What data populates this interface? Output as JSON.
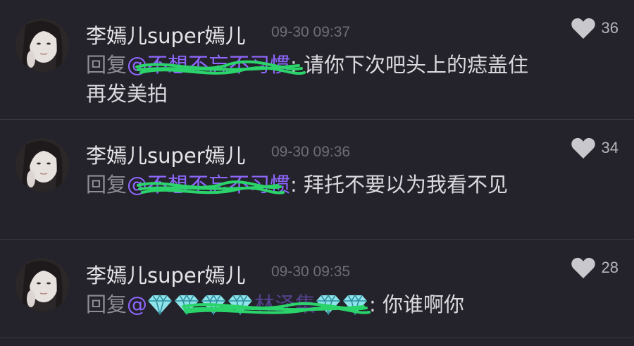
{
  "comments": [
    {
      "username": "李嫣儿super嫣儿",
      "time": "09-30 09:37",
      "likes": "36",
      "reply_prefix": "回复",
      "mention": "@不想不忘不习惯",
      "colon": ":",
      "text": "请你下次吧头上的痣盖住再发美拍"
    },
    {
      "username": "李嫣儿super嫣儿",
      "time": "09-30 09:36",
      "likes": "34",
      "reply_prefix": "回复",
      "mention": "@不想不忘不习惯",
      "colon": ":",
      "text": "拜托不要以为我看不见"
    },
    {
      "username": "李嫣儿super嫣儿",
      "time": "09-30 09:35",
      "likes": "28",
      "reply_prefix": "回复",
      "mention": "@",
      "mention_name": "林泽集",
      "colon": ":",
      "text": "你谁啊你"
    }
  ],
  "icons": {
    "like": "heart-icon",
    "gem": "diamond-icon"
  },
  "colors": {
    "background": "#24232b",
    "mention": "#8f67ff",
    "scribble": "#2bd46b",
    "heart": "#c9c8cd"
  }
}
